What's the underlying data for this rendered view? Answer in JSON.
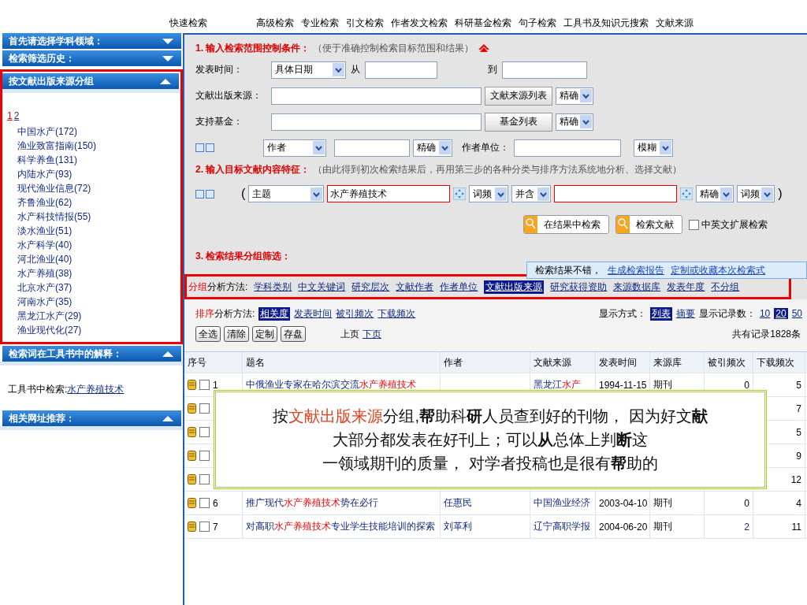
{
  "top_nav": [
    "快速检索",
    "高级检索",
    "专业检索",
    "引文检索",
    "作者发文检索",
    "科研基金检索",
    "句子检索",
    "工具书及知识元搜索",
    "文献来源"
  ],
  "sidebar": {
    "sections": [
      {
        "title": "首先请选择学科领域：",
        "expanded": false,
        "highlighted": false
      },
      {
        "title": "检索筛选历史：",
        "expanded": false,
        "highlighted": false
      },
      {
        "title": "按文献出版来源分组",
        "expanded": true,
        "highlighted": true,
        "kind": "source_list",
        "pages": [
          {
            "label": "1",
            "selected": true
          },
          {
            "label": "2",
            "selected": false
          }
        ],
        "items": [
          "中国水产(172)",
          "渔业致富指南(150)",
          "科学养鱼(131)",
          "内陆水产(93)",
          "现代渔业信息(72)",
          "齐鲁渔业(62)",
          "水产科技情报(55)",
          "淡水渔业(51)",
          "水产科学(40)",
          "河北渔业(40)",
          "水产养殖(38)",
          "北京水产(37)",
          "河南水产(35)",
          "黑龙江水产(29)",
          "渔业现代化(27)"
        ]
      },
      {
        "title": "检索词在工具书中的解释：",
        "expanded": true,
        "highlighted": false,
        "kind": "toolbook",
        "text": "工具书中检索:",
        "link": "水产养殖技术"
      },
      {
        "title": "相关网址推荐：",
        "expanded": true,
        "highlighted": false,
        "kind": "blank"
      }
    ]
  },
  "search_form": {
    "section1": {
      "title": "1. 输入检索范围控制条件：",
      "hint": "（便于准确控制检索目标范围和结果）"
    },
    "date_row": {
      "label": "发表时间：",
      "mode": "具体日期",
      "from_label": "从",
      "to_label": "到"
    },
    "source_row": {
      "label": "文献出版来源：",
      "button": "文献来源列表",
      "match": "精确"
    },
    "fund_row": {
      "label": "支持基金：",
      "button": "基金列表",
      "match": "精确"
    },
    "author_row": {
      "field": "作者",
      "match": "精确",
      "unit_label": "作者单位：",
      "unit_match": "模糊"
    },
    "section2": {
      "title": "2. 输入目标文献内容特征：",
      "hint": "（由此得到初次检索结果后，再用第三步的各种分类与排序方法系统地分析、选择文献）"
    },
    "content_row": {
      "open": "(",
      "field": "主题",
      "value": "水产养殖技术",
      "freq1": "词频",
      "logic": "并含",
      "match": "精确",
      "freq2": "词频",
      "close": ")"
    },
    "actions": {
      "buttons": [
        "在结果中检索",
        "检索文献"
      ],
      "expand": {
        "label": "中英文扩展检索",
        "checked": false
      }
    }
  },
  "results": {
    "section3": "3. 检索结果分组筛选：",
    "notice": {
      "text": "检索结果不错，",
      "links": [
        "生成检索报告",
        "定制或收藏本次检索式"
      ]
    },
    "grouping": {
      "prefix": "分组",
      "label": "分析方法:",
      "highlighted": true,
      "options": [
        {
          "label": "学科类别",
          "selected": false
        },
        {
          "label": "中文关键词",
          "selected": false
        },
        {
          "label": "研究层次",
          "selected": false
        },
        {
          "label": "文献作者",
          "selected": false
        },
        {
          "label": "作者单位",
          "selected": false
        },
        {
          "label": "文献出版来源",
          "selected": true
        },
        {
          "label": "研究获得资助",
          "selected": false
        },
        {
          "label": "来源数据库",
          "selected": false
        },
        {
          "label": "发表年度",
          "selected": false
        },
        {
          "label": "不分组",
          "selected": false
        }
      ]
    },
    "sorting": {
      "prefix": "排序",
      "label": "分析方法:",
      "options": [
        {
          "label": "相关度",
          "selected": true
        },
        {
          "label": "发表时间",
          "selected": false
        },
        {
          "label": "被引频次",
          "selected": false
        },
        {
          "label": "下载频次",
          "selected": false
        }
      ]
    },
    "display": {
      "label": "显示方式：",
      "modes": [
        {
          "label": "列表",
          "selected": true
        },
        {
          "label": "摘要",
          "selected": false
        }
      ],
      "count_label": "显示记录数：",
      "counts": [
        {
          "label": "10",
          "selected": false
        },
        {
          "label": "20",
          "selected": true
        },
        {
          "label": "50",
          "selected": false
        }
      ]
    },
    "buttons": [
      "全选",
      "清除",
      "定制",
      "存盘"
    ],
    "pager": {
      "prev": "上页",
      "next": "下页"
    },
    "total": "共有记录1828条",
    "table": {
      "columns": [
        "序号",
        "题名",
        "作者",
        "文献来源",
        "发表时间",
        "来源库",
        "被引频次",
        "下载频次"
      ],
      "rows": [
        {
          "no": "1",
          "checked": false,
          "title": [
            {
              "t": "中俄渔业专家在哈尔滨交流",
              "hit": false
            },
            {
              "t": "水产养殖技术",
              "hit": true
            }
          ],
          "source": [
            {
              "t": "黑龙江",
              "hit": false
            },
            {
              "t": "水产",
              "hit": true
            }
          ],
          "date": "1994-11-15",
          "db": "期刊",
          "cited": "0",
          "cited_linked": false,
          "downloads": "5"
        },
        {
          "checked": false,
          "downloads": "7"
        },
        {
          "checked": false,
          "downloads": "5"
        },
        {
          "checked": false,
          "downloads": "9"
        },
        {
          "checked": false,
          "downloads": "12"
        },
        {
          "no": "6",
          "checked": false,
          "title": [
            {
              "t": "推广现代",
              "hit": false
            },
            {
              "t": "水产养殖技术",
              "hit": true
            },
            {
              "t": "势在必行",
              "hit": false
            }
          ],
          "author": "任惠民",
          "source": [
            {
              "t": "中国渔业经济",
              "hit": false
            }
          ],
          "date": "2003-04-10",
          "db": "期刊",
          "cited": "0",
          "cited_linked": false,
          "downloads": "4"
        },
        {
          "no": "7",
          "checked": false,
          "title": [
            {
              "t": "对高职",
              "hit": false
            },
            {
              "t": "水产养殖技术",
              "hit": true
            },
            {
              "t": "专业学生技能培训的探索",
              "hit": false
            }
          ],
          "author": "刘革利",
          "source": [
            {
              "t": "辽宁高职学报",
              "hit": false
            }
          ],
          "date": "2004-06-20",
          "db": "期刊",
          "cited": "2",
          "cited_linked": true,
          "downloads": "11"
        }
      ]
    }
  },
  "callout": {
    "lines": [
      [
        {
          "t": "按",
          "hit": false
        },
        {
          "t": "文献出版来源",
          "hit": true
        },
        {
          "t": "分组,**帮**助科**研**人员查到好的刊物，  因为好文**献**",
          "hit": false
        }
      ],
      [
        {
          "t": "大部分都发表在好刊上；可以**从**总体上判**断**这",
          "hit": false
        }
      ],
      [
        {
          "t": "一领域期刊的质量，  对学者投稿也是很有**帮**助的",
          "hit": false
        }
      ]
    ]
  }
}
